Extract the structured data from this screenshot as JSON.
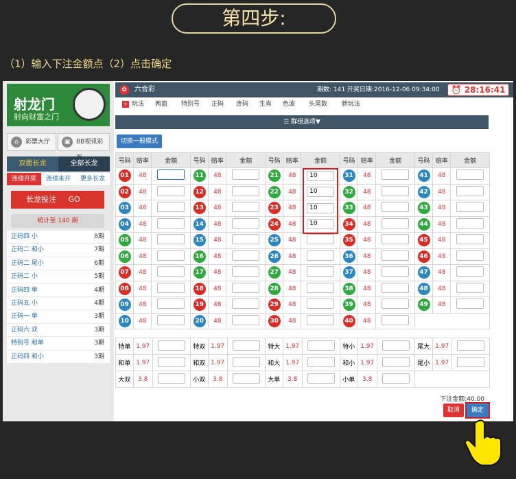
{
  "step_title": "第四步:",
  "instruction": "（1）输入下注金额点（2）点击确定",
  "sidebar": {
    "logo_text": "射龙门",
    "logo_sub": "射向财富之门",
    "btn_lobby": "彩票大厅",
    "btn_video": "BB视讯彩票",
    "tab_active": "双面长龙",
    "tab_other": "全部长龙",
    "subtabs": [
      "连续开奖",
      "连续未开",
      "更多长龙"
    ],
    "long_btn": "长龙投注",
    "long_go": "GO",
    "stat": "统计至 140 期",
    "items": [
      {
        "label": "正码四 小",
        "count": "8期"
      },
      {
        "label": "正码二 和小",
        "count": "7期"
      },
      {
        "label": "正码二 尾小",
        "count": "6期"
      },
      {
        "label": "正码二 小",
        "count": "5期"
      },
      {
        "label": "正码四 单",
        "count": "4期"
      },
      {
        "label": "正码五 小",
        "count": "4期"
      },
      {
        "label": "正码一 单",
        "count": "3期"
      },
      {
        "label": "正码六 双",
        "count": "3期"
      },
      {
        "label": "特别号 和单",
        "count": "3期"
      },
      {
        "label": "正码四 和小",
        "count": "3期"
      }
    ]
  },
  "top": {
    "game": "六合彩",
    "info": "期数: 141   开奖日期:2016-12-06 09:34:00",
    "timer": "28:16:41"
  },
  "nav": [
    "玩法",
    "两面",
    "特别号",
    "正码",
    "连码",
    "生肖",
    "色波",
    "头尾数",
    "新玩法"
  ],
  "group_label": "群组选项▼",
  "mode_btn": "切换一般模式",
  "headers": [
    "号码",
    "赔率",
    "金额"
  ],
  "odds": "48",
  "side_bets": [
    [
      [
        "特单",
        "1.97"
      ],
      [
        "特双",
        "1.97"
      ],
      [
        "特大",
        "1.97"
      ],
      [
        "特小",
        "1.97"
      ],
      [
        "尾大",
        "1.97"
      ]
    ],
    [
      [
        "和单",
        "1.97"
      ],
      [
        "和双",
        "1.97"
      ],
      [
        "和大",
        "1.97"
      ],
      [
        "和小",
        "1.97"
      ],
      [
        "尾小",
        "1.97"
      ]
    ],
    [
      [
        "大双",
        "3.8"
      ],
      [
        "小双",
        "3.8"
      ],
      [
        "大单",
        "3.8"
      ],
      [
        "小单",
        "3.8"
      ]
    ]
  ],
  "total": "下注金额:40.00",
  "cancel": "取消",
  "confirm": "确定",
  "colors": {
    "red": "#d92c25",
    "green": "#2faa3e",
    "blue": "#2c86c2",
    "accent": "#3a7bbf"
  }
}
